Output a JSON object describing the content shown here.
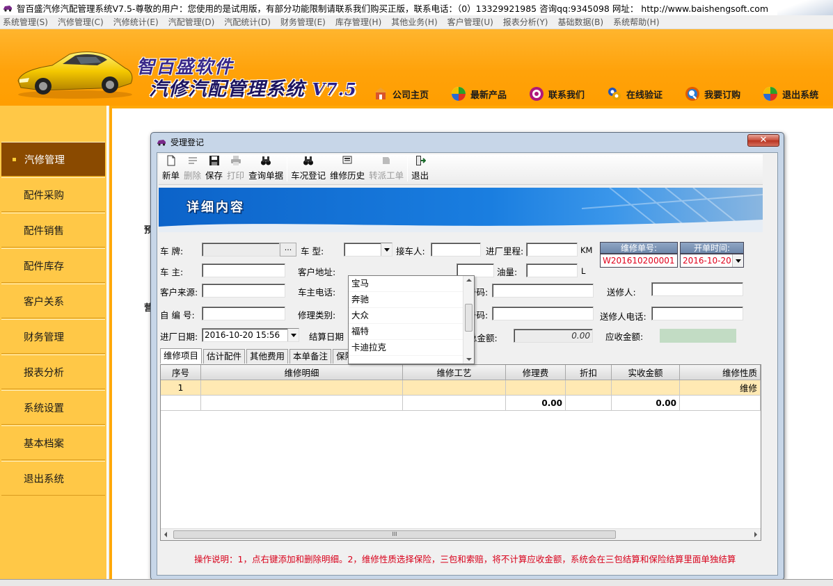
{
  "window": {
    "title": "智百盛汽修汽配管理系统V7.5-尊敬的用户：您使用的是试用版，有部分功能限制请联系我们购买正版，联系电话：（0）13329921985  咨询qq:9345098   网址： http://www.baishengsoft.com"
  },
  "menubar": {
    "items": [
      "系统管理(S)",
      "汽修管理(C)",
      "汽修统计(E)",
      "汽配管理(D)",
      "汽配统计(D)",
      "财务管理(E)",
      "库存管理(H)",
      "其他业务(H)",
      "客户管理(U)",
      "报表分析(Y)",
      "基础数据(B)",
      "系统帮助(H)"
    ]
  },
  "banner": {
    "brand": "智百盛软件",
    "product": "汽修汽配管理系统",
    "version": "V7.5",
    "links": [
      {
        "label": "公司主页",
        "icon": "home-icon",
        "color": "#d9552b"
      },
      {
        "label": "最新产品",
        "icon": "pinwheel-icon",
        "color": "#2a8a2a"
      },
      {
        "label": "联系我们",
        "icon": "contact-icon",
        "color": "#b0187a"
      },
      {
        "label": "在线验证",
        "icon": "verify-icon",
        "color": "#2255bb"
      },
      {
        "label": "我要订购",
        "icon": "order-icon",
        "color": "#e05a00"
      },
      {
        "label": "退出系统",
        "icon": "exit-pinwheel-icon",
        "color": "#2a8a2a"
      }
    ]
  },
  "sidebar": {
    "items": [
      {
        "label": "汽修管理",
        "active": true
      },
      {
        "label": "配件采购"
      },
      {
        "label": "配件销售"
      },
      {
        "label": "配件库存"
      },
      {
        "label": "客户关系"
      },
      {
        "label": "财务管理"
      },
      {
        "label": "报表分析"
      },
      {
        "label": "系统设置"
      },
      {
        "label": "基本档案"
      },
      {
        "label": "退出系统"
      }
    ]
  },
  "background": {
    "ghost1": "预",
    "ghost2": "营"
  },
  "dialog": {
    "title": "受理登记",
    "close": "✕",
    "toolbar": {
      "new": "新单",
      "delete": "删除",
      "save": "保存",
      "print": "打印",
      "query": "查询单据",
      "vehicle_check": "车况登记",
      "repair_history": "维修历史",
      "dispatch": "转派工单",
      "exit": "退出"
    },
    "header_title": "详细内容",
    "form": {
      "plate_label": "车    牌:",
      "plate_value": "",
      "ellipsis": "...",
      "model_label": "车    型:",
      "model_value": "",
      "receiver_label": "接车人:",
      "receiver_value": "",
      "mileage_label": "进厂里程:",
      "mileage_value": "",
      "mileage_unit": "KM",
      "owner_label": "车    主:",
      "owner_value": "",
      "address_label": "客户地址:",
      "address_value": "",
      "fuel_label": "油量:",
      "fuel_value": "",
      "fuel_unit": "L",
      "source_label": "客户来源:",
      "source_value": "",
      "owner_phone_label": "车主电话:",
      "code1_label": "号码:",
      "code1_value": "",
      "sender_label": "送修人:",
      "sender_value": "",
      "selfcode_label": "自 编 号:",
      "selfcode_value": "",
      "repair_type_label": "修理类别:",
      "code2_label": "号码:",
      "code2_value": "",
      "sender_phone_label": "送修人电话:",
      "sender_phone_value": "",
      "entry_date_label": "进厂日期:",
      "entry_date_value": "2016-10-20 15:56",
      "settle_date_label": "结算日期",
      "total_label": "总金额:",
      "total_value": "0.00",
      "receivable_label": "应收金额:",
      "receivable_value": ""
    },
    "order": {
      "no_label": "维修单号:",
      "no_value": "W201610200001",
      "time_label": "开单时间:",
      "time_value": "2016-10-20"
    },
    "model_options": [
      "宝马",
      "奔驰",
      "大众",
      "福特",
      "卡迪拉克"
    ],
    "tabs": [
      "维修项目",
      "估计配件",
      "其他费用",
      "本单备注",
      "保险索赔"
    ],
    "grid": {
      "columns": [
        "序号",
        "维修明细",
        "维修工艺",
        "修理费",
        "折扣",
        "实收金额",
        "维修性质"
      ],
      "rows": [
        [
          "1",
          "",
          "",
          "",
          "",
          "",
          "维修"
        ]
      ],
      "totals": [
        "",
        "",
        "",
        "0.00",
        "",
        "0.00",
        ""
      ],
      "scroll_grip": "III"
    },
    "note": "操作说明：1，点右键添加和删除明细。2，维修性质选择保险，三包和索赔，将不计算应收金额，系统会在三包结算和保险结算里面单独结算"
  }
}
